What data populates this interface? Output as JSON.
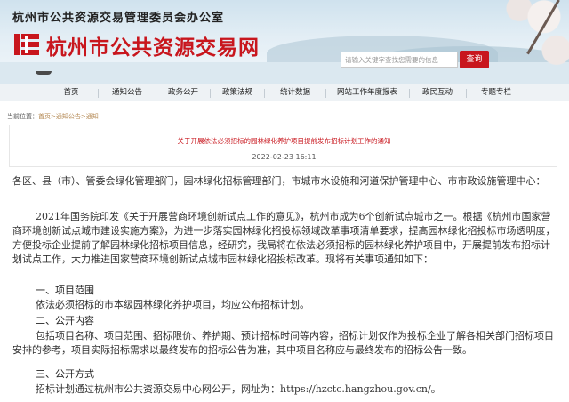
{
  "header": {
    "org_name": "杭州市公共资源交易管理委员会办公室",
    "site_name": "杭州市公共资源交易网",
    "search_placeholder": "请输入关键字查找您需要的信息",
    "search_button": "查询"
  },
  "nav": {
    "items": [
      "首页",
      "通知公告",
      "政务公开",
      "政策法规",
      "统计数据",
      "网站工作年度报表",
      "政民互动",
      "专题专栏"
    ]
  },
  "breadcrumb": {
    "prefix": "当前位置：",
    "items": [
      "首页",
      "通知公告",
      "通知"
    ],
    "separator": ">"
  },
  "article": {
    "title": "关于开展依法必须招标的园林绿化养护项目提前发布招标计划工作的通知",
    "date": "2022-02-23 16:11",
    "salutation": "各区、县（市）、管委会绿化管理部门，园林绿化招标管理部门，市城市水设施和河道保护管理中心、市市政设施管理中心：",
    "intro": "2021年国务院印发《关于开展营商环境创新试点工作的意见》，杭州市成为6个创新试点城市之一。根据《杭州市国家营商环境创新试点城市建设实施方案》，为进一步落实园林绿化招投标领域改革事项清单要求，提高园林绿化招投标市场透明度，方便投标企业提前了解园林绿化招标项目信息，经研究，我局将在依法必须招标的园林绿化养护项目中，开展提前发布招标计划试点工作，大力推进国家营商环境创新试点城市园林绿化招投标改革。现将有关事项通知如下：",
    "sections": [
      {
        "heading": "一、项目范围",
        "text": "依法必须招标的市本级园林绿化养护项目，均应公布招标计划。"
      },
      {
        "heading": "二、公开内容",
        "text": "包括项目名称、项目范围、招标限价、养护期、预计招标时间等内容，招标计划仅作为投标企业了解各相关部门招标项目安排的参考，项目实际招标需求以最终发布的招标公告为准，其中项目名称应与最终发布的招标公告一致。"
      },
      {
        "heading": "三、公开方式",
        "text": "招标计划通过杭州市公共资源交易中心网公开，网址为：https://hzctc.hangzhou.gov.cn/。"
      }
    ]
  },
  "colors": {
    "brand_red": "#c8161d",
    "nav_bg": "#eef2f5",
    "breadcrumb_link": "#b58a55"
  }
}
